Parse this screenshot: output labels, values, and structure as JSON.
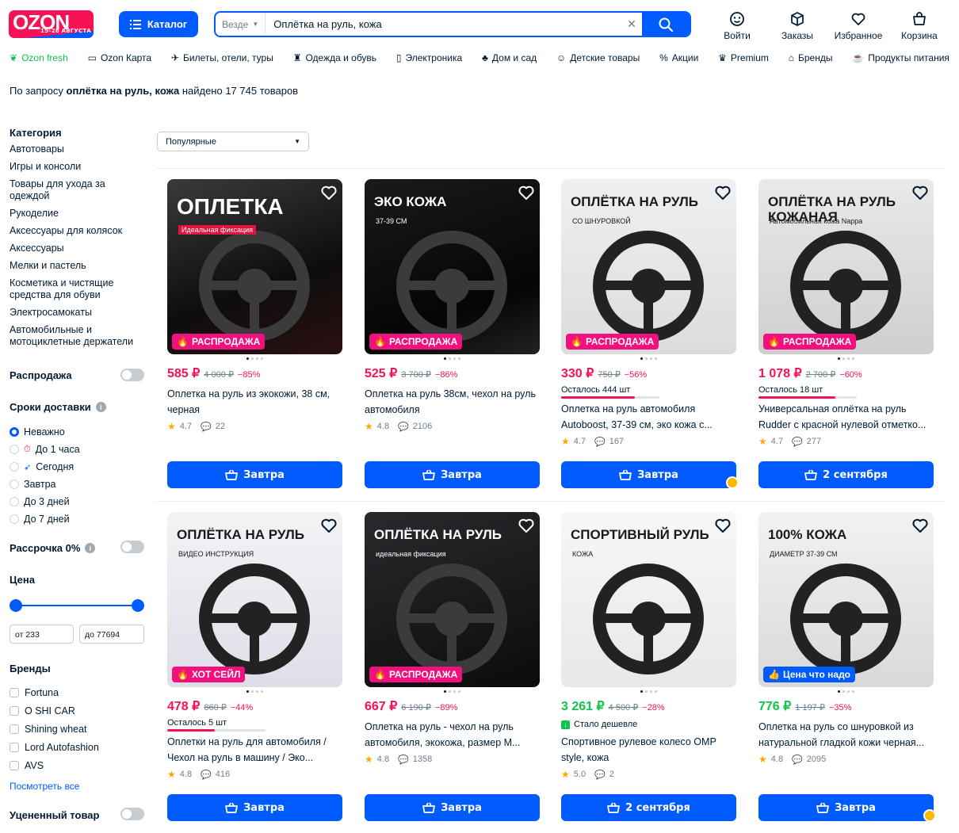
{
  "header": {
    "logo_text": "OZON",
    "logo_sub": "15–28 АВГУСТА",
    "catalog_label": "Каталог",
    "search_scope": "Везде",
    "search_value": "Оплётка на руль, кожа",
    "icons": [
      {
        "label": "Войти",
        "icon": "smile-icon"
      },
      {
        "label": "Заказы",
        "icon": "box-icon"
      },
      {
        "label": "Избранное",
        "icon": "heart-icon"
      },
      {
        "label": "Корзина",
        "icon": "cart-icon"
      }
    ]
  },
  "nav": [
    "Ozon fresh",
    "Ozon Карта",
    "Билеты, отели, туры",
    "Одежда и обувь",
    "Электроника",
    "Дом и сад",
    "Детские товары",
    "Акции",
    "Premium",
    "Бренды",
    "Продукты питания"
  ],
  "results": {
    "prefix": "По запросу ",
    "query": "оплётка на руль, кожа",
    "suffix": " найдено 17 745 товаров"
  },
  "sidebar": {
    "category_title": "Категория",
    "categories": [
      "Автотовары",
      "Игры и консоли",
      "Товары для ухода за одеждой",
      "Рукоделие",
      "Аксессуары для колясок",
      "Аксессуары",
      "Мелки и пастель",
      "Косметика и чистящие средства для обуви",
      "Электросамокаты",
      "Автомобильные и мотоциклетные держатели"
    ],
    "sale_label": "Распродажа",
    "delivery_title": "Сроки доставки",
    "delivery_options": [
      "Неважно",
      "До 1 часа",
      "Сегодня",
      "Завтра",
      "До 3 дней",
      "До 7 дней"
    ],
    "installment_label": "Рассрочка 0%",
    "price_title": "Цена",
    "price_from": "от 233",
    "price_to": "до 77694",
    "brands_title": "Бренды",
    "brands": [
      "Fortuna",
      "O SHI CAR",
      "Shining wheat",
      "Lord Autofashion",
      "AVS"
    ],
    "see_all": "Посмотреть все",
    "discounted_label": "Уцененный товар"
  },
  "sort": {
    "label": "Популярные"
  },
  "products": [
    {
      "price": "585 ₽",
      "old": "4 000 ₽",
      "disc": "−85%",
      "title": "Оплетка на руль из экокожи, 38 см, черная",
      "rating": "4.7",
      "reviews": "22",
      "badge": "РАСПРОДАЖА",
      "button": "Завтра",
      "img_text": "ОПЛЕТКА",
      "img_sub": "Идеальная фиксация"
    },
    {
      "price": "525 ₽",
      "old": "3 700 ₽",
      "disc": "−86%",
      "title": "Оплетка на руль 38см, чехол на руль автомобиля",
      "rating": "4.8",
      "reviews": "2106",
      "badge": "РАСПРОДАЖА",
      "button": "Завтра",
      "img_text": "ЭКО КОЖА",
      "img_sub": "37-39 СМ"
    },
    {
      "price": "330 ₽",
      "old": "750 ₽",
      "disc": "−56%",
      "left": "Осталось 444 шт",
      "left_frac": 0.75,
      "title": "Оплетка на руль автомобиля Autoboost, 37-39 см, эко кожа с...",
      "rating": "4.7",
      "reviews": "167",
      "badge": "РАСПРОДАЖА",
      "button": "Завтра",
      "img_text": "ОПЛЁТКА НА РУЛЬ",
      "img_sub": "СО ШНУРОВКОЙ"
    },
    {
      "price": "1 078 ₽",
      "old": "2 700 ₽",
      "disc": "−60%",
      "left": "Осталось 18 шт",
      "left_frac": 0.78,
      "title": "Универсальная оплётка на руль Rudder с красной нулевой отметко...",
      "rating": "4.7",
      "reviews": "277",
      "badge": "РАСПРОДАЖА",
      "button": "2 сентября",
      "img_text": "ОПЛЁТКА НА РУЛЬ КОЖАНАЯ",
      "img_sub": "Автомобильная кожа Nappa"
    },
    {
      "price": "478 ₽",
      "old": "860 ₽",
      "disc": "−44%",
      "left": "Осталось 5 шт",
      "left_frac": 0.48,
      "title": "Оплетки на руль для автомобиля / Чехол на руль в машину / Эко...",
      "rating": "4.8",
      "reviews": "416",
      "badge": "ХОТ СЕЙЛ",
      "button": "Завтра",
      "img_text": "ОПЛЁТКА НА РУЛЬ",
      "img_sub": "ВИДЕО ИНСТРУКЦИЯ"
    },
    {
      "price": "667 ₽",
      "old": "6 190 ₽",
      "disc": "−89%",
      "title": "Оплетка на руль - чехол на руль автомобиля, экокожа, размер М...",
      "rating": "4.8",
      "reviews": "1358",
      "badge": "РАСПРОДАЖА",
      "button": "Завтра",
      "img_text": "ОПЛЁТКА НА РУЛЬ",
      "img_sub": "идеальная фиксация"
    },
    {
      "price": "3 261 ₽",
      "old": "4 500 ₽",
      "disc": "−28%",
      "green": true,
      "cheaper": "Стало дешевле",
      "title": "Спортивное рулевое колесо OMP style, кожа",
      "rating": "5.0",
      "reviews": "2",
      "badge": "",
      "button": "2 сентября",
      "img_text": "СПОРТИВНЫЙ РУЛЬ",
      "img_sub": "КОЖА"
    },
    {
      "price": "776 ₽",
      "old": "1 197 ₽",
      "disc": "−35%",
      "green": true,
      "title": "Оплетка на руль со шнуровкой из натуральной гладкой кожи черная...",
      "rating": "4.8",
      "reviews": "2095",
      "badge": "Цена что надо",
      "badge_blue": true,
      "button": "Завтра",
      "img_text": "100% КОЖА",
      "img_sub": "ДИАМЕТР 37-39 СМ"
    }
  ],
  "colors": {
    "brand_blue": "#005bff",
    "accent_pink": "#f91155",
    "badge_pink": "#f1117e",
    "green": "#10c44c"
  }
}
